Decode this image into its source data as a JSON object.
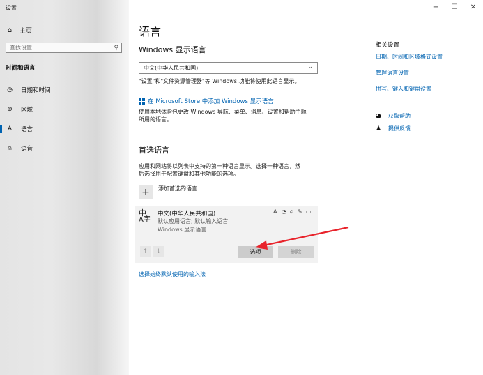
{
  "window": {
    "title": "设置",
    "controls": {
      "minimize": "−",
      "maximize": "☐",
      "close": "✕"
    }
  },
  "sidebar": {
    "home": {
      "label": "主页",
      "icon": "home-icon"
    },
    "search": {
      "placeholder": "查找设置",
      "icon": "search-icon"
    },
    "section": "时间和语言",
    "items": [
      {
        "label": "日期和时间",
        "icon": "calendar-clock-icon"
      },
      {
        "label": "区域",
        "icon": "globe-icon"
      },
      {
        "label": "语言",
        "icon": "language-icon",
        "active": true
      },
      {
        "label": "语音",
        "icon": "microphone-icon"
      }
    ]
  },
  "main": {
    "title": "语言",
    "display_language": {
      "heading": "Windows 显示语言",
      "selected": "中文(中华人民共和国)",
      "description": "\"设置\"和\"文件资源管理器\"等 Windows 功能将使用此语言显示。",
      "store_link": "在 Microsoft Store 中添加 Windows 显示语言",
      "store_description_line1": "使用本地体验包更改 Windows 导航、菜单、消息、设置和帮助主题",
      "store_description_line2": "所用的语言。"
    },
    "preferred": {
      "heading": "首选语言",
      "description_line1": "应用和网站将以列表中支持的第一种语言显示。选择一种语言，然",
      "description_line2": "后选择用于配置键盘和其他功能的选项。",
      "add_label": "添加首选的语言",
      "languages": [
        {
          "name": "中文(中华人民共和国)",
          "line1": "默认应用语言; 默认输入语言",
          "line2": "Windows 显示语言",
          "glyph_top": "中",
          "glyph_bottom": "A字"
        }
      ],
      "options_label": "选项",
      "remove_label": "删除",
      "up_label": "↑",
      "down_label": "↓"
    },
    "input_method_link": "选择始终默认使用的输入法"
  },
  "related": {
    "heading": "相关设置",
    "links": [
      "日期、时间和区域格式设置",
      "管理语言设置",
      "拼写、键入和键盘设置"
    ],
    "help": [
      {
        "label": "获取帮助",
        "icon": "help-chat-icon"
      },
      {
        "label": "提供反馈",
        "icon": "feedback-icon"
      }
    ]
  },
  "colors": {
    "accent": "#0063b1",
    "annotation_arrow": "#e8232b"
  }
}
